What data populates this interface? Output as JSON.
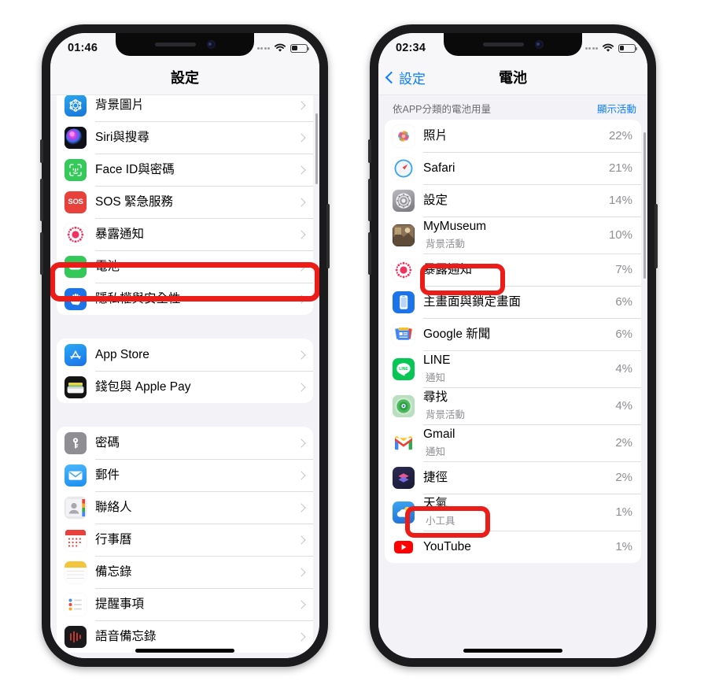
{
  "meta": {
    "accent_blue": "#0a7cff",
    "annotation_red": "#ec1c18",
    "screen_bg": "#f2f2f7"
  },
  "left_phone": {
    "name": "settings-screen",
    "status": {
      "time": "01:46",
      "wifi": "wifi-icon",
      "battery": "battery-icon",
      "signal": "signal-dots"
    },
    "nav": {
      "title": "設定"
    },
    "groups": [
      {
        "rows": [
          {
            "label": "背景圖片",
            "icon": "wallpaper-icon"
          },
          {
            "label": "Siri與搜尋",
            "icon": "siri-icon"
          },
          {
            "label": "Face ID與密碼",
            "icon": "faceid-icon"
          },
          {
            "label": "SOS 緊急服務",
            "icon": "sos-icon"
          },
          {
            "label": "暴露通知",
            "icon": "exposure-icon"
          },
          {
            "label": "電池",
            "icon": "battery-settings-icon",
            "highlighted": true
          },
          {
            "label": "隱私權與安全性",
            "icon": "privacy-icon"
          }
        ]
      },
      {
        "rows": [
          {
            "label": "App Store",
            "icon": "appstore-icon"
          },
          {
            "label": "錢包與 Apple Pay",
            "icon": "wallet-icon"
          }
        ]
      },
      {
        "rows": [
          {
            "label": "密碼",
            "icon": "passwords-icon"
          },
          {
            "label": "郵件",
            "icon": "mail-icon"
          },
          {
            "label": "聯絡人",
            "icon": "contacts-icon"
          },
          {
            "label": "行事曆",
            "icon": "calendar-icon"
          },
          {
            "label": "備忘錄",
            "icon": "notes-icon"
          },
          {
            "label": "提醒事項",
            "icon": "reminders-icon"
          },
          {
            "label": "語音備忘錄",
            "icon": "voicememos-icon"
          }
        ]
      }
    ]
  },
  "right_phone": {
    "name": "battery-screen",
    "status": {
      "time": "02:34",
      "wifi": "wifi-icon",
      "battery": "battery-icon",
      "signal": "signal-dots"
    },
    "nav": {
      "back_label": "設定",
      "title": "電池"
    },
    "section": {
      "header": "依APP分類的電池用量",
      "action": "顯示活動"
    },
    "apps": [
      {
        "name": "照片",
        "sub": "",
        "pct": "22%",
        "icon": "photos-icon"
      },
      {
        "name": "Safari",
        "sub": "",
        "pct": "21%",
        "icon": "safari-icon"
      },
      {
        "name": "設定",
        "sub": "",
        "pct": "14%",
        "icon": "settings-icon"
      },
      {
        "name": "MyMuseum",
        "sub": "背景活動",
        "pct": "10%",
        "icon": "mymuseum-icon",
        "sub_highlighted": true
      },
      {
        "name": "暴露通知",
        "sub": "",
        "pct": "7%",
        "icon": "exposure-icon"
      },
      {
        "name": "主畫面與鎖定畫面",
        "sub": "",
        "pct": "6%",
        "icon": "homescreen-icon"
      },
      {
        "name": "Google 新聞",
        "sub": "",
        "pct": "6%",
        "icon": "googlenews-icon"
      },
      {
        "name": "LINE",
        "sub": "通知",
        "pct": "4%",
        "icon": "line-icon"
      },
      {
        "name": "尋找",
        "sub": "背景活動",
        "pct": "4%",
        "icon": "findmy-icon"
      },
      {
        "name": "Gmail",
        "sub": "通知",
        "pct": "2%",
        "icon": "gmail-icon",
        "sub_highlighted": true
      },
      {
        "name": "捷徑",
        "sub": "",
        "pct": "2%",
        "icon": "shortcuts-icon"
      },
      {
        "name": "天氣",
        "sub": "小工具",
        "pct": "1%",
        "icon": "weather-icon"
      },
      {
        "name": "YouTube",
        "sub": "",
        "pct": "1%",
        "icon": "youtube-icon"
      }
    ]
  }
}
